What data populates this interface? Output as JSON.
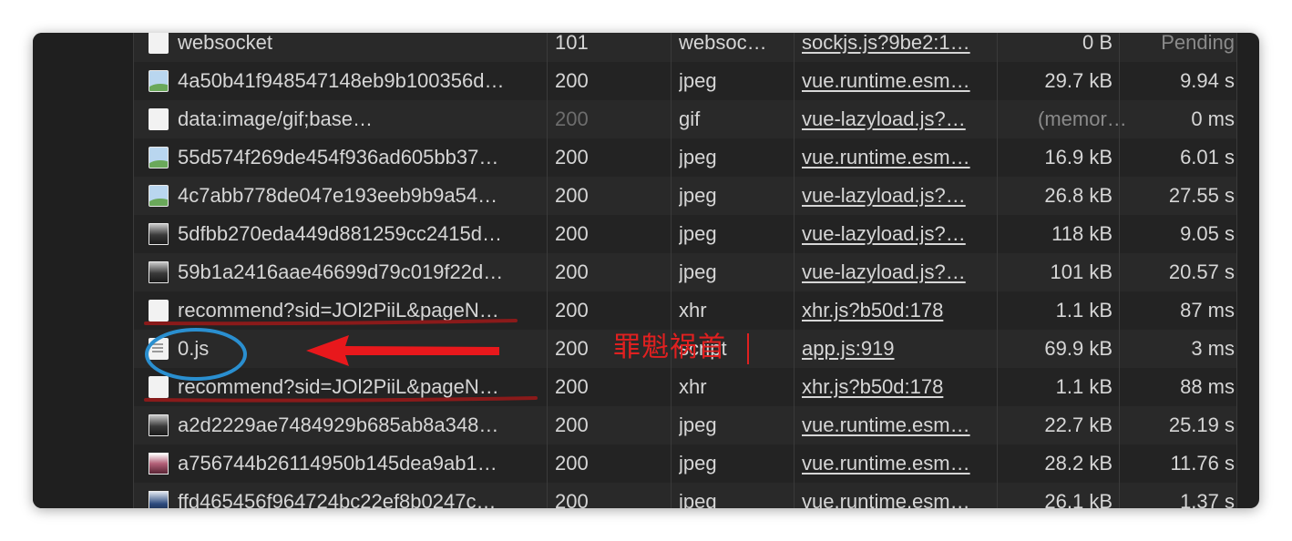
{
  "network": {
    "rows": [
      {
        "name": "websocket",
        "status": "101",
        "type": "websoc…",
        "initiator": "sockjs.js?9be2:1…",
        "size": "0 B",
        "time": "Pending",
        "icon": "document-icon"
      },
      {
        "name": "4a50b41f948547148eb9b100356d…",
        "status": "200",
        "type": "jpeg",
        "initiator": "vue.runtime.esm…",
        "size": "29.7 kB",
        "time": "9.94 s",
        "icon": "image-icon"
      },
      {
        "name": "data:image/gif;base…",
        "status": "200",
        "type": "gif",
        "initiator": "vue-lazyload.js?…",
        "size": "(memor…",
        "time": "0 ms",
        "icon": "document-icon"
      },
      {
        "name": "55d574f269de454f936ad605bb37…",
        "status": "200",
        "type": "jpeg",
        "initiator": "vue.runtime.esm…",
        "size": "16.9 kB",
        "time": "6.01 s",
        "icon": "image-icon"
      },
      {
        "name": "4c7abb778de047e193eeb9b9a54…",
        "status": "200",
        "type": "jpeg",
        "initiator": "vue-lazyload.js?…",
        "size": "26.8 kB",
        "time": "27.55 s",
        "icon": "image-icon"
      },
      {
        "name": "5dfbb270eda449d881259cc2415d…",
        "status": "200",
        "type": "jpeg",
        "initiator": "vue-lazyload.js?…",
        "size": "118 kB",
        "time": "9.05 s",
        "icon": "photo-thumbnail-icon"
      },
      {
        "name": "59b1a2416aae46699d79c019f22d…",
        "status": "200",
        "type": "jpeg",
        "initiator": "vue-lazyload.js?…",
        "size": "101 kB",
        "time": "20.57 s",
        "icon": "photo-thumbnail-icon"
      },
      {
        "name": "recommend?sid=JOl2PiiL&pageN…",
        "status": "200",
        "type": "xhr",
        "initiator": "xhr.js?b50d:178",
        "size": "1.1 kB",
        "time": "87 ms",
        "icon": "document-icon"
      },
      {
        "name": "0.js",
        "status": "200",
        "type": "script",
        "initiator": "app.js:919",
        "size": "69.9 kB",
        "time": "3 ms",
        "icon": "script-file-icon"
      },
      {
        "name": "recommend?sid=JOl2PiiL&pageN…",
        "status": "200",
        "type": "xhr",
        "initiator": "xhr.js?b50d:178",
        "size": "1.1 kB",
        "time": "88 ms",
        "icon": "document-icon"
      },
      {
        "name": "a2d2229ae7484929b685ab8a348…",
        "status": "200",
        "type": "jpeg",
        "initiator": "vue.runtime.esm…",
        "size": "22.7 kB",
        "time": "25.19 s",
        "icon": "photo-thumbnail-icon"
      },
      {
        "name": "a756744b26114950b145dea9ab1…",
        "status": "200",
        "type": "jpeg",
        "initiator": "vue.runtime.esm…",
        "size": "28.2 kB",
        "time": "11.76 s",
        "icon": "photo-thumbnail-icon"
      },
      {
        "name": "ffd465456f964724bc22ef8b0247c…",
        "status": "200",
        "type": "jpeg",
        "initiator": "vue.runtime.esm…",
        "size": "26.1 kB",
        "time": "1.37 s",
        "icon": "photo-thumbnail-icon"
      }
    ]
  },
  "annotation": {
    "text": "罪魁祸首",
    "color": "#e02020",
    "underline_color": "#8a1a1a"
  }
}
